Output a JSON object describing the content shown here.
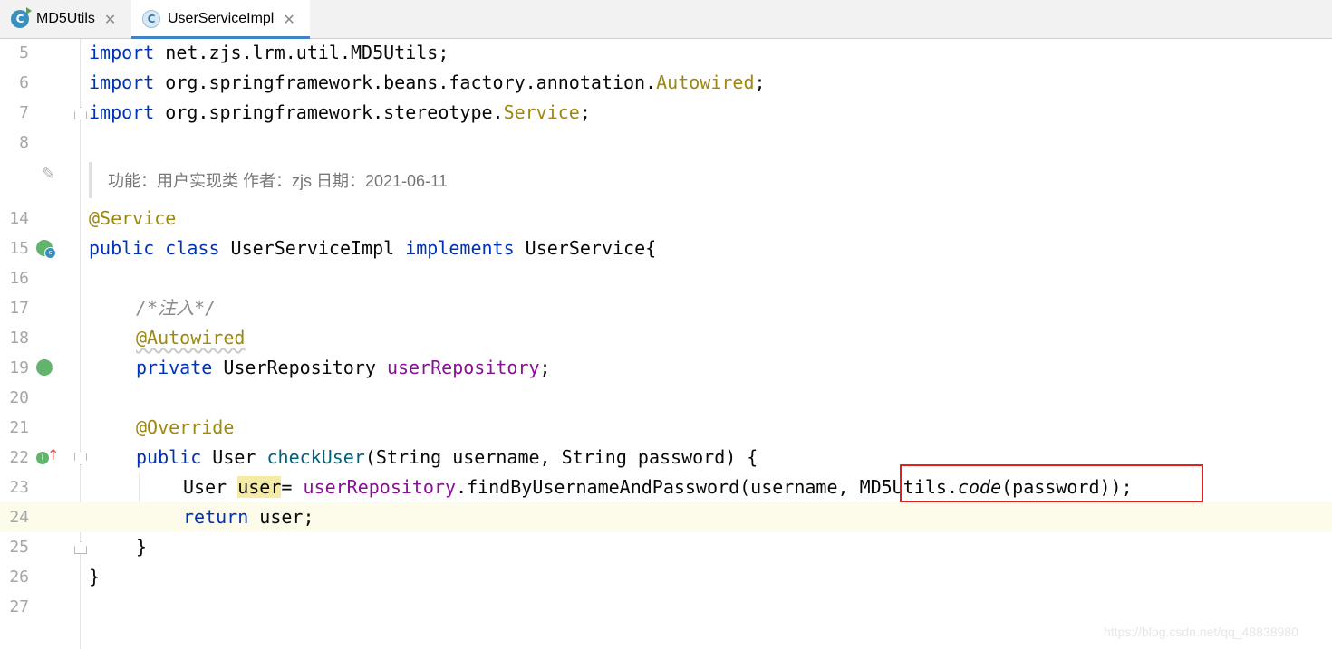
{
  "tabs": [
    {
      "label": "MD5Utils",
      "icon": "class-icon",
      "close": "✕"
    },
    {
      "label": "UserServiceImpl",
      "icon": "class-icon",
      "close": "✕",
      "active": true
    }
  ],
  "doc_comment": "功能：用户实现类 作者：zjs 日期：2021-06-11",
  "lines": {
    "l5": {
      "num": "5",
      "kw": "import",
      "rest": " net.zjs.lrm.util.MD5Utils;"
    },
    "l6": {
      "num": "6",
      "kw": "import",
      "pkg": " org.springframework.beans.factory.annotation.",
      "cls": "Autowired",
      "end": ";"
    },
    "l7": {
      "num": "7",
      "kw": "import",
      "pkg": " org.springframework.stereotype.",
      "cls": "Service",
      "end": ";"
    },
    "l8": {
      "num": "8"
    },
    "l14": {
      "num": "14",
      "ann": "@Service"
    },
    "l15": {
      "num": "15",
      "kw1": "public",
      "kw2": "class",
      "name": " UserServiceImpl ",
      "kw3": "implements",
      "rest": " UserService{"
    },
    "l16": {
      "num": "16"
    },
    "l17": {
      "num": "17",
      "comment": "/*注入*/"
    },
    "l18": {
      "num": "18",
      "ann": "@Autowired"
    },
    "l19": {
      "num": "19",
      "kw": "private",
      "type": " UserRepository ",
      "field": "userRepository",
      "end": ";"
    },
    "l20": {
      "num": "20"
    },
    "l21": {
      "num": "21",
      "ann": "@Override"
    },
    "l22": {
      "num": "22",
      "kw": "public",
      "type": " User ",
      "method": "checkUser",
      "rest": "(String username, String password) {"
    },
    "l23": {
      "num": "23",
      "type": "User ",
      "var": "user",
      "eq": "= ",
      "field": "userRepository",
      "call": ".findByUsernameAndPassword(username, ",
      "util": "MD5Utils.",
      "umethod": "code",
      "tail": "(password));"
    },
    "l24": {
      "num": "24",
      "kw": "return",
      "rest": " user;"
    },
    "l25": {
      "num": "25",
      "rest": "}"
    },
    "l26": {
      "num": "26",
      "rest": "}"
    },
    "l27": {
      "num": "27"
    }
  },
  "watermark": "https://blog.csdn.net/qq_48838980",
  "colors": {
    "keyword": "#0033b3",
    "annotation": "#9e880d",
    "field": "#871094",
    "method": "#00627a",
    "highlight_box": "#e02020"
  }
}
